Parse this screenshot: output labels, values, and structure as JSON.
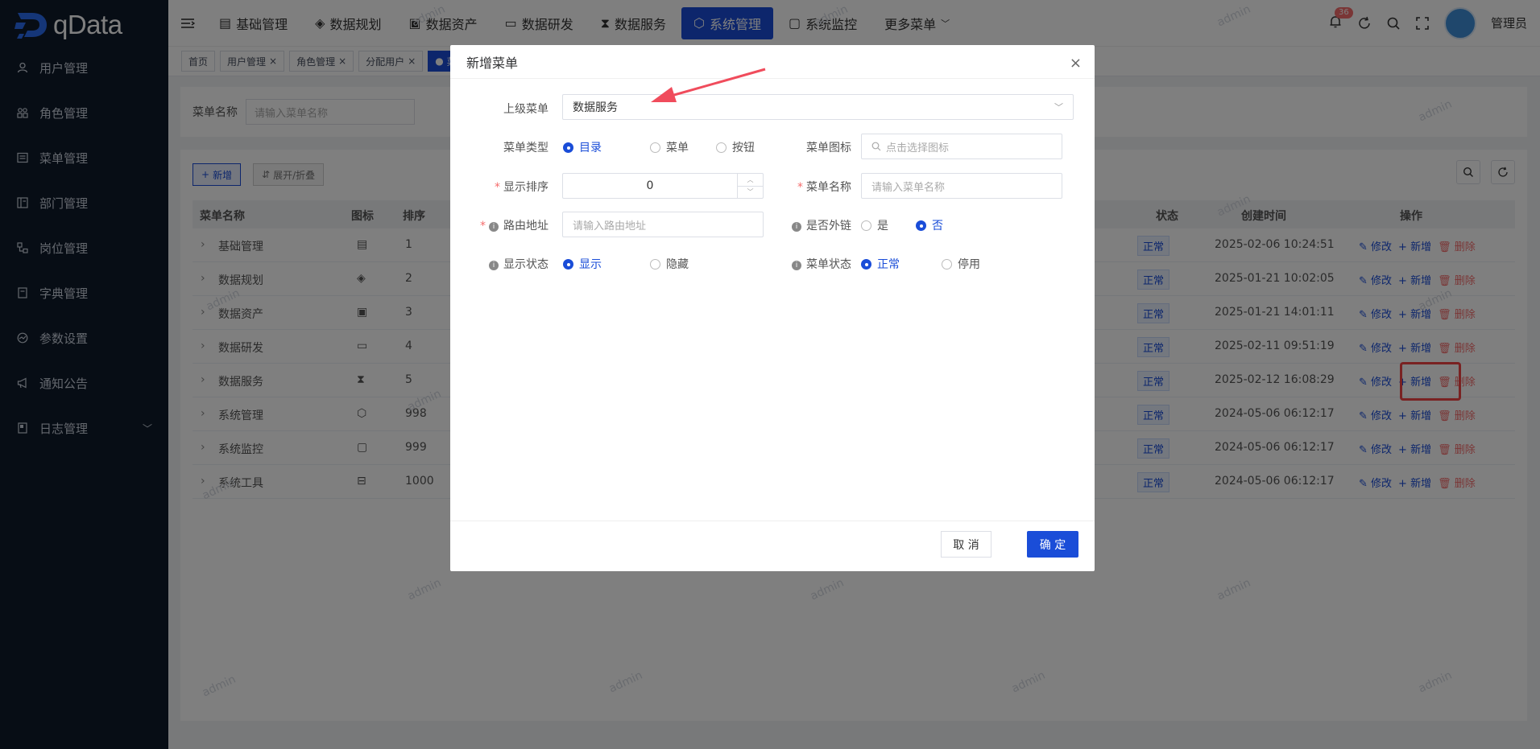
{
  "app": {
    "logo_text": "qData"
  },
  "sidebar": {
    "items": [
      {
        "label": "用户管理",
        "icon": "user-icon"
      },
      {
        "label": "角色管理",
        "icon": "people-icon"
      },
      {
        "label": "菜单管理",
        "icon": "list-icon"
      },
      {
        "label": "部门管理",
        "icon": "dept-icon"
      },
      {
        "label": "岗位管理",
        "icon": "post-icon"
      },
      {
        "label": "字典管理",
        "icon": "book-icon"
      },
      {
        "label": "参数设置",
        "icon": "gauge-icon"
      },
      {
        "label": "通知公告",
        "icon": "megaphone-icon"
      },
      {
        "label": "日志管理",
        "icon": "log-icon"
      }
    ]
  },
  "topnav": {
    "items": [
      {
        "label": "基础管理"
      },
      {
        "label": "数据规划"
      },
      {
        "label": "数据资产"
      },
      {
        "label": "数据研发"
      },
      {
        "label": "数据服务"
      },
      {
        "label": "系统管理"
      },
      {
        "label": "系统监控"
      },
      {
        "label": "更多菜单"
      }
    ],
    "notification_count": "36",
    "user_name": "管理员"
  },
  "tags": [
    "首页",
    "用户管理",
    "角色管理",
    "分配用户",
    "菜"
  ],
  "search": {
    "label": "菜单名称",
    "placeholder": "请输入菜单名称"
  },
  "toolbar": {
    "add_label": "新增",
    "expand_label": "展开/折叠"
  },
  "table": {
    "headers": {
      "name": "菜单名称",
      "icon": "图标",
      "order": "排序",
      "status": "状态",
      "created": "创建时间",
      "ops": "操作"
    },
    "rows": [
      {
        "name": "基础管理",
        "order": "1",
        "status": "正常",
        "created": "2025-02-06 10:24:51"
      },
      {
        "name": "数据规划",
        "order": "2",
        "status": "正常",
        "created": "2025-01-21 10:02:05"
      },
      {
        "name": "数据资产",
        "order": "3",
        "status": "正常",
        "created": "2025-01-21 14:01:11"
      },
      {
        "name": "数据研发",
        "order": "4",
        "status": "正常",
        "created": "2025-02-11 09:51:19"
      },
      {
        "name": "数据服务",
        "order": "5",
        "status": "正常",
        "created": "2025-02-12 16:08:29"
      },
      {
        "name": "系统管理",
        "order": "998",
        "status": "正常",
        "created": "2024-05-06 06:12:17"
      },
      {
        "name": "系统监控",
        "order": "999",
        "status": "正常",
        "created": "2024-05-06 06:12:17"
      },
      {
        "name": "系统工具",
        "order": "1000",
        "status": "正常",
        "created": "2024-05-06 06:12:17"
      }
    ],
    "op_edit": "修改",
    "op_add": "新增",
    "op_delete": "删除"
  },
  "watermark_text": "admin",
  "modal": {
    "title": "新增菜单",
    "parent_label": "上级菜单",
    "parent_value": "数据服务",
    "type_label": "菜单类型",
    "type_options": [
      "目录",
      "菜单",
      "按钮"
    ],
    "icon_label": "菜单图标",
    "icon_placeholder": "点击选择图标",
    "order_label": "显示排序",
    "order_value": "0",
    "name_label": "菜单名称",
    "name_placeholder": "请输入菜单名称",
    "route_label": "路由地址",
    "route_placeholder": "请输入路由地址",
    "external_label": "是否外链",
    "external_options": [
      "是",
      "否"
    ],
    "visible_label": "显示状态",
    "visible_options": [
      "显示",
      "隐藏"
    ],
    "status_label": "菜单状态",
    "status_options": [
      "正常",
      "停用"
    ],
    "cancel_label": "取 消",
    "ok_label": "确 定"
  },
  "colors": {
    "accent": "#1a4dd8",
    "sidebar_bg": "#0f1a2b",
    "danger": "#f56c6c",
    "highlight": "#f24545"
  }
}
